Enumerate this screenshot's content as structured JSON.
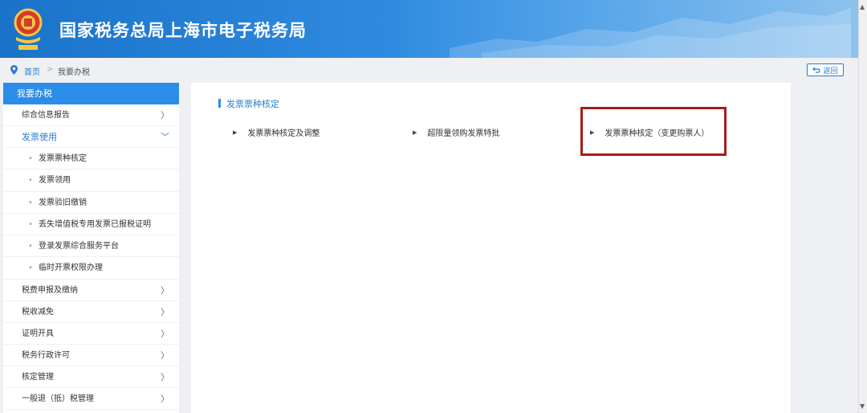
{
  "header": {
    "title": "国家税务总局上海市电子税务局"
  },
  "breadcrumb": {
    "home": "首页",
    "separator": ">",
    "current": "我要办税"
  },
  "back_button": {
    "label": "返回"
  },
  "sidebar": {
    "header": "我要办税",
    "items_top": [
      {
        "label": "综合信息报告",
        "arrow": "〉"
      }
    ],
    "open_item": {
      "label": "发票使用",
      "arrow": "﹀"
    },
    "sub_items": [
      {
        "label": "发票票种核定"
      },
      {
        "label": "发票领用"
      },
      {
        "label": "发票验旧缴销"
      },
      {
        "label": "丢失增值税专用发票已报税证明"
      },
      {
        "label": "登录发票综合服务平台"
      },
      {
        "label": "临时开票权限办理"
      }
    ],
    "items_bottom": [
      {
        "label": "税费申报及缴纳",
        "arrow": "〉"
      },
      {
        "label": "税收减免",
        "arrow": "〉"
      },
      {
        "label": "证明开具",
        "arrow": "〉"
      },
      {
        "label": "税务行政许可",
        "arrow": "〉"
      },
      {
        "label": "核定管理",
        "arrow": "〉"
      },
      {
        "label": "一般退（抵）税管理",
        "arrow": "〉"
      }
    ]
  },
  "content": {
    "section_title": "发票票种核定",
    "links": [
      {
        "label": "发票票种核定及调整"
      },
      {
        "label": "超限量领购发票特批"
      },
      {
        "label": "发票票种核定（变更购票人）"
      }
    ]
  },
  "colors": {
    "accent": "#2c8de8",
    "highlight_box": "#a61c1c"
  }
}
